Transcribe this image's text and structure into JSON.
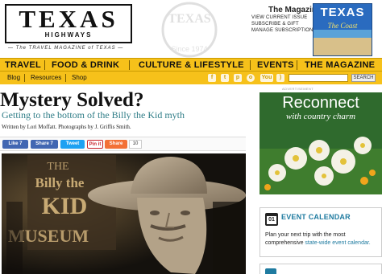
{
  "header": {
    "logo_main": "TEXAS",
    "logo_sub": "HIGHWAYS",
    "logo_tagline": "— The TRAVEL MAGAZINE of TEXAS —",
    "watermark": "TEXAS",
    "watermark_year": "Since 1974",
    "magazine_title": "The Magazine",
    "magazine_links": [
      "VIEW CURRENT ISSUE",
      "SUBSCRIBE & GIFT",
      "MANAGE SUBSCRIPTION"
    ],
    "cover_title": "TEXAS",
    "cover_subtitle": "The Coast"
  },
  "main_nav": {
    "items": [
      "TRAVEL",
      "FOOD & DRINK",
      "CULTURE & LIFESTYLE",
      "EVENTS",
      "THE MAGAZINE"
    ]
  },
  "sub_nav": {
    "items": [
      "Blog",
      "Resources",
      "Shop"
    ],
    "social_icons": [
      "facebook-icon",
      "twitter-icon",
      "pinterest-icon",
      "instagram-icon",
      "youtube-icon",
      "rss-icon"
    ],
    "search_button": "SEARCH",
    "youtube_label": "You"
  },
  "article": {
    "headline": "Mystery Solved?",
    "dek": "Getting to the bottom of the Billy the Kid myth",
    "byline": "Written by Lori Moffatt. Photographs by J. Griffis Smith.",
    "share": {
      "like": "Like 7",
      "share_fb": "Share 7",
      "tweet": "Tweet",
      "pin": "Pin it",
      "share": "Share",
      "count": "10"
    },
    "photo_sign": [
      "THE",
      "Billy the",
      "KID",
      "MUSEUM"
    ]
  },
  "sidebar": {
    "ad_label": "ADVERTISEMENT",
    "ad_title": "Reconnect",
    "ad_subtitle": "with country charm",
    "event_day": "01",
    "event_title": "EVENT CALENDAR",
    "event_text": "Plan your next trip with the most comprehensive",
    "event_link": "state-wide event calendar."
  },
  "colors": {
    "nav_yellow": "#f6c11a",
    "dek_teal": "#2f7d87",
    "link_blue": "#1f7ba0",
    "ad_green": "#2f6a2d"
  }
}
